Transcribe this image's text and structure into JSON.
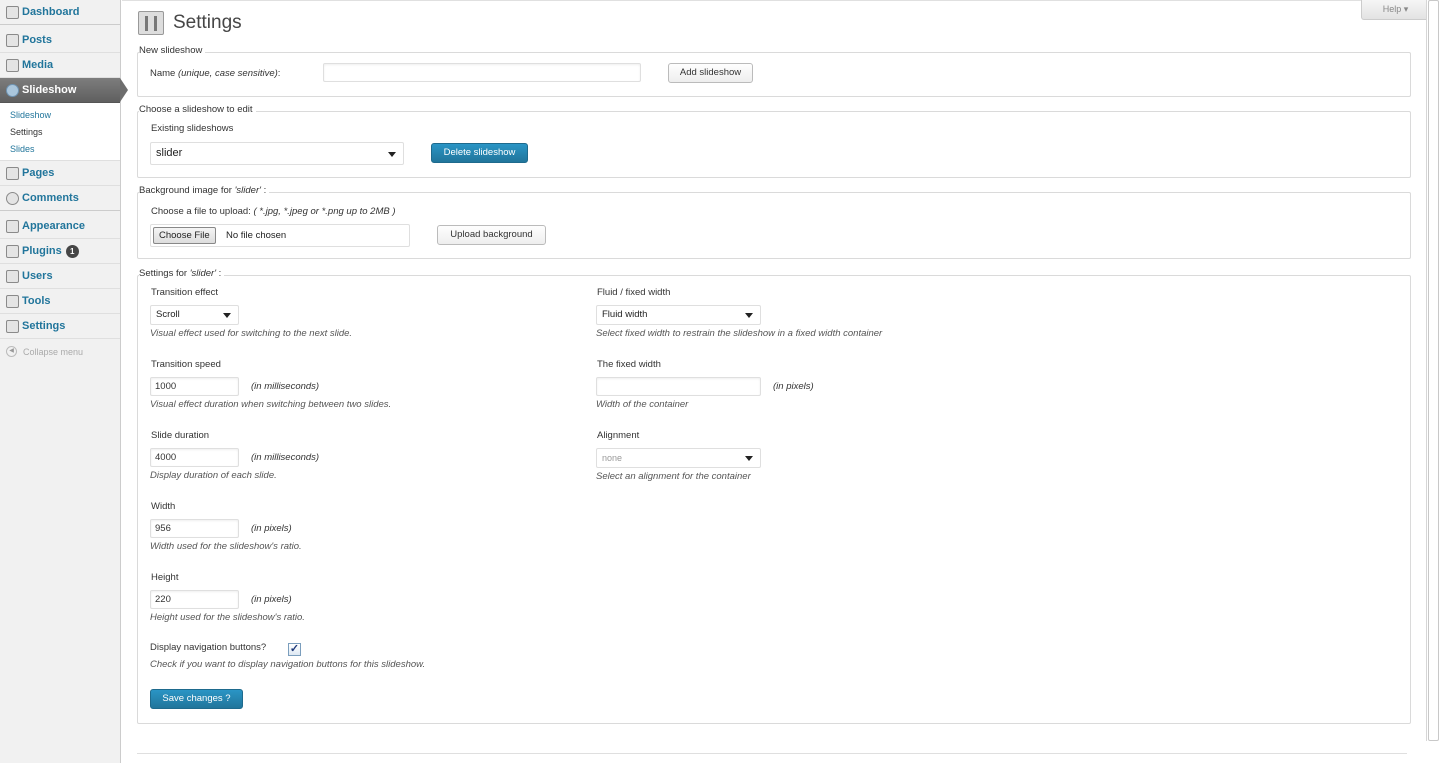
{
  "sidebar": {
    "items": [
      {
        "label": "Dashboard",
        "icon": "dashboard-icon"
      },
      {
        "label": "Posts",
        "icon": "pin-icon"
      },
      {
        "label": "Media",
        "icon": "media-icon"
      },
      {
        "label": "Slideshow",
        "icon": "gear-icon"
      },
      {
        "label": "Pages",
        "icon": "page-icon"
      },
      {
        "label": "Comments",
        "icon": "speech-bubble-icon"
      },
      {
        "label": "Appearance",
        "icon": "brush-icon"
      },
      {
        "label": "Plugins",
        "icon": "plug-icon",
        "badge": "1"
      },
      {
        "label": "Users",
        "icon": "users-icon"
      },
      {
        "label": "Tools",
        "icon": "wrench-icon"
      },
      {
        "label": "Settings",
        "icon": "sliders-icon"
      }
    ],
    "submenu": [
      "Slideshow",
      "Settings",
      "Slides"
    ],
    "collapse_label": "Collapse menu"
  },
  "header": {
    "title": "Settings",
    "help_label": "Help ▾"
  },
  "new_slideshow": {
    "legend": "New slideshow",
    "name_label": "Name",
    "name_hint": "(unique, case sensitive)",
    "name_colon": ":",
    "name_value": "",
    "add_label": "Add slideshow"
  },
  "choose": {
    "legend": "Choose a slideshow to edit",
    "existing_label": "Existing slideshows",
    "selected": "slider",
    "delete_label": "Delete slideshow"
  },
  "background": {
    "legend_prefix": "Background image for ",
    "legend_name": "'slider'",
    "legend_suffix": " :",
    "upload_label": "Choose a file to upload:",
    "upload_hint": "( *.jpg, *.jpeg or *.png up to 2MB )",
    "choose_file_label": "Choose File",
    "no_file_label": "No file chosen",
    "upload_button": "Upload background"
  },
  "settings": {
    "legend_prefix": "Settings for ",
    "legend_name": "'slider'",
    "legend_suffix": " :",
    "transition_effect": {
      "label": "Transition effect",
      "value": "Scroll",
      "desc": "Visual effect used for switching to the next slide."
    },
    "transition_speed": {
      "label": "Transition speed",
      "value": "1000",
      "unit": "(in milliseconds)",
      "desc": "Visual effect duration when switching between two slides."
    },
    "slide_duration": {
      "label": "Slide duration",
      "value": "4000",
      "unit": "(in milliseconds)",
      "desc": "Display duration of each slide."
    },
    "width": {
      "label": "Width",
      "value": "956",
      "unit": "(in pixels)",
      "desc": "Width used for the slideshow's ratio."
    },
    "height": {
      "label": "Height",
      "value": "220",
      "unit": "(in pixels)",
      "desc": "Height used for the slideshow's ratio."
    },
    "nav_buttons": {
      "label": "Display navigation buttons?",
      "checked": "✓",
      "desc": "Check if you want to display navigation buttons for this slideshow."
    },
    "fluid": {
      "label": "Fluid / fixed width",
      "value": "Fluid width",
      "desc": "Select fixed width to restrain the slideshow in a fixed width container"
    },
    "fixed_width": {
      "label": "The fixed width",
      "value": "",
      "unit": "(in pixels)",
      "desc": "Width of the container"
    },
    "alignment": {
      "label": "Alignment",
      "value": "none",
      "desc": "Select an alignment for the container"
    },
    "save_label": "Save changes ?"
  },
  "colors": {
    "accent": "#21759b",
    "sidebar_bg": "#f1f1f1"
  }
}
